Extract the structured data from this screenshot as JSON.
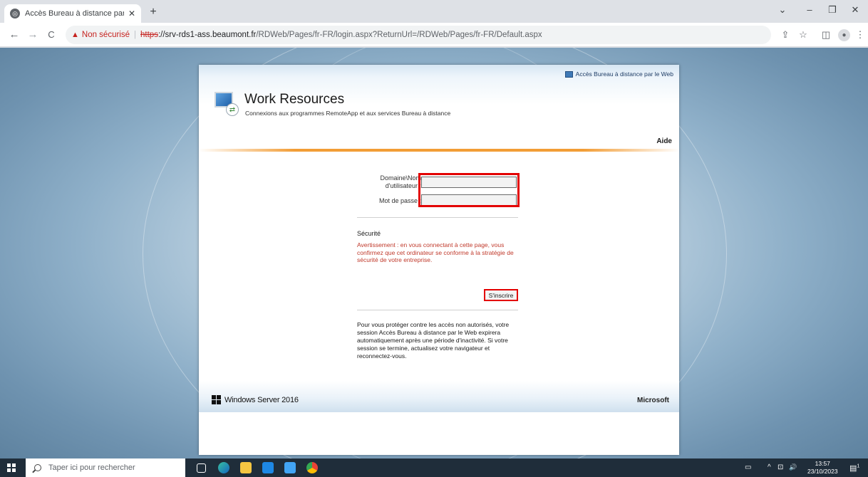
{
  "browser": {
    "tab_title": "Accès Bureau à distance par le W",
    "new_tab": "+",
    "window_controls": {
      "minimize_glyph": "–",
      "restore_glyph": "❐",
      "close_glyph": "✕",
      "tabsearch_glyph": "⌄"
    },
    "nav": {
      "back_glyph": "←",
      "forward_glyph": "→",
      "reload_glyph": "C"
    },
    "security_icon": "warning-triangle-icon",
    "security_label": "Non sécurisé",
    "separator": "|",
    "url_scheme": "https",
    "url_host": "://srv-rds1-ass.beaumont.fr",
    "url_path": "/RDWeb/Pages/fr-FR/login.aspx?ReturnUrl=/RDWeb/Pages/fr-FR/Default.aspx",
    "toolbar_icons": [
      "share-icon",
      "bookmark-star-icon",
      "side-panel-icon",
      "profile-icon",
      "menu-icon"
    ]
  },
  "page": {
    "rdweb_link": "Accès Bureau à distance par le Web",
    "workspace_title": "Work Resources",
    "workspace_subtitle": "Connexions aux programmes RemoteApp et aux services Bureau à distance",
    "help_link": "Aide",
    "form": {
      "domain_label_line1": "Domaine\\Nom",
      "domain_label_line2": "d'utilisateur :",
      "domain_value": "",
      "password_label": "Mot de passe :",
      "password_value": ""
    },
    "security_title": "Sécurité",
    "security_warning": "Avertissement : en vous connectant à cette page, vous confirmez que cet ordinateur se conforme à la stratégie de sécurité de votre entreprise.",
    "sign_in_button": "S'inscrire",
    "protection_note": "Pour vous protéger contre les accès non autorisés, votre session Accès Bureau à distance par le Web expirera automatiquement après une période d'inactivité. Si votre session se termine, actualisez votre navigateur et reconnectez-vous.",
    "footer_brand": "Windows Server 2016",
    "footer_vendor": "Microsoft",
    "colors": {
      "accent_orange": "#f29d36",
      "highlight_red": "#e30000",
      "warning_text": "#c0392b"
    }
  },
  "taskbar": {
    "search_placeholder": "Taper ici pour rechercher",
    "apps": [
      "task-view-icon",
      "edge-icon",
      "file-explorer-icon",
      "store-icon",
      "mail-icon",
      "chrome-icon"
    ],
    "tray_chevron": "^",
    "tray_network": "⊡",
    "tray_volume": "🔊",
    "time": "13:57",
    "date": "23/10/2023",
    "notification_count": "1"
  }
}
